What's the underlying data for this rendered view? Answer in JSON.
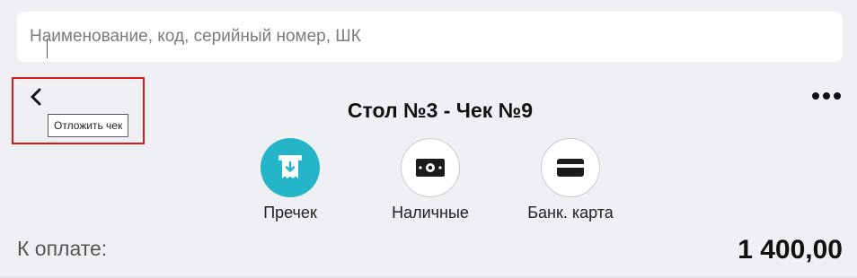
{
  "search": {
    "placeholder": "Наименование, код, серийный номер, ШК",
    "value": ""
  },
  "header": {
    "back_tooltip": "Отложить чек",
    "title": "Стол №3 - Чек №9",
    "more_icon": "more-horizontal-icon"
  },
  "actions": [
    {
      "label": "Пречек",
      "icon": "receipt-download-icon",
      "color": "#24b5c8"
    },
    {
      "label": "Наличные",
      "icon": "cash-icon",
      "color": "#ffffff"
    },
    {
      "label": "Банк. карта",
      "icon": "credit-card-icon",
      "color": "#ffffff"
    }
  ],
  "total": {
    "label": "К оплате:",
    "value": "1 400,00"
  },
  "colors": {
    "accent": "#24b5c8",
    "highlight": "#d81a1a",
    "background": "#eff0f4"
  }
}
